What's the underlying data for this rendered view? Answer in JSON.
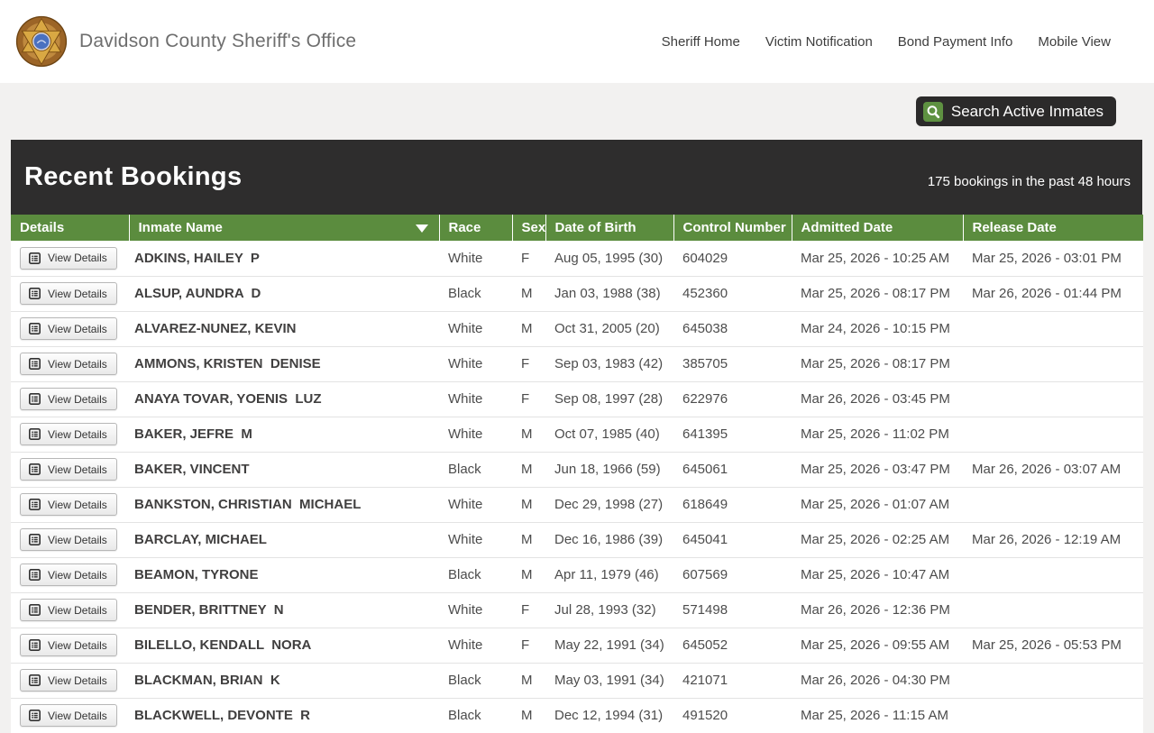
{
  "header": {
    "title": "Davidson County Sheriff's Office",
    "nav": [
      {
        "label": "Sheriff Home"
      },
      {
        "label": "Victim Notification"
      },
      {
        "label": "Bond Payment Info"
      },
      {
        "label": "Mobile View"
      }
    ]
  },
  "toolbar": {
    "search_label": "Search Active Inmates"
  },
  "bookings": {
    "title": "Recent Bookings",
    "summary": "175 bookings in the past 48 hours",
    "view_details_label": "View Details",
    "columns": [
      "Details",
      "Inmate Name",
      "Race",
      "Sex",
      "Date of Birth",
      "Control Number",
      "Admitted Date",
      "Release Date"
    ],
    "sorted_column": "Inmate Name",
    "sort_direction": "asc",
    "rows": [
      {
        "name": "ADKINS, HAILEY  P",
        "race": "White",
        "sex": "F",
        "dob": "Aug 05, 1995 (30)",
        "control": "604029",
        "admitted": "Mar 25, 2026 - 10:25 AM",
        "released": "Mar 25, 2026 - 03:01 PM"
      },
      {
        "name": "ALSUP, AUNDRA  D",
        "race": "Black",
        "sex": "M",
        "dob": "Jan 03, 1988 (38)",
        "control": "452360",
        "admitted": "Mar 25, 2026 - 08:17 PM",
        "released": "Mar 26, 2026 - 01:44 PM"
      },
      {
        "name": "ALVAREZ-NUNEZ, KEVIN",
        "race": "White",
        "sex": "M",
        "dob": "Oct 31, 2005 (20)",
        "control": "645038",
        "admitted": "Mar 24, 2026 - 10:15 PM",
        "released": ""
      },
      {
        "name": "AMMONS, KRISTEN  DENISE",
        "race": "White",
        "sex": "F",
        "dob": "Sep 03, 1983 (42)",
        "control": "385705",
        "admitted": "Mar 25, 2026 - 08:17 PM",
        "released": ""
      },
      {
        "name": "ANAYA TOVAR, YOENIS  LUZ",
        "race": "White",
        "sex": "F",
        "dob": "Sep 08, 1997 (28)",
        "control": "622976",
        "admitted": "Mar 26, 2026 - 03:45 PM",
        "released": ""
      },
      {
        "name": "BAKER, JEFRE  M",
        "race": "White",
        "sex": "M",
        "dob": "Oct 07, 1985 (40)",
        "control": "641395",
        "admitted": "Mar 25, 2026 - 11:02 PM",
        "released": ""
      },
      {
        "name": "BAKER, VINCENT",
        "race": "Black",
        "sex": "M",
        "dob": "Jun 18, 1966 (59)",
        "control": "645061",
        "admitted": "Mar 25, 2026 - 03:47 PM",
        "released": "Mar 26, 2026 - 03:07 AM"
      },
      {
        "name": "BANKSTON, CHRISTIAN  MICHAEL",
        "race": "White",
        "sex": "M",
        "dob": "Dec 29, 1998 (27)",
        "control": "618649",
        "admitted": "Mar 25, 2026 - 01:07 AM",
        "released": ""
      },
      {
        "name": "BARCLAY, MICHAEL",
        "race": "White",
        "sex": "M",
        "dob": "Dec 16, 1986 (39)",
        "control": "645041",
        "admitted": "Mar 25, 2026 - 02:25 AM",
        "released": "Mar 26, 2026 - 12:19 AM"
      },
      {
        "name": "BEAMON, TYRONE",
        "race": "Black",
        "sex": "M",
        "dob": "Apr 11, 1979 (46)",
        "control": "607569",
        "admitted": "Mar 25, 2026 - 10:47 AM",
        "released": ""
      },
      {
        "name": "BENDER, BRITTNEY  N",
        "race": "White",
        "sex": "F",
        "dob": "Jul 28, 1993 (32)",
        "control": "571498",
        "admitted": "Mar 26, 2026 - 12:36 PM",
        "released": ""
      },
      {
        "name": "BILELLO, KENDALL  NORA",
        "race": "White",
        "sex": "F",
        "dob": "May 22, 1991 (34)",
        "control": "645052",
        "admitted": "Mar 25, 2026 - 09:55 AM",
        "released": "Mar 25, 2026 - 05:53 PM"
      },
      {
        "name": "BLACKMAN, BRIAN  K",
        "race": "Black",
        "sex": "M",
        "dob": "May 03, 1991 (34)",
        "control": "421071",
        "admitted": "Mar 26, 2026 - 04:30 PM",
        "released": ""
      },
      {
        "name": "BLACKWELL, DEVONTE  R",
        "race": "Black",
        "sex": "M",
        "dob": "Dec 12, 1994 (31)",
        "control": "491520",
        "admitted": "Mar 25, 2026 - 11:15 AM",
        "released": ""
      }
    ]
  },
  "colors": {
    "table_header_green": "#5b8c3e",
    "dark_band": "#2e2d2d",
    "search_icon_green": "#5e9141",
    "page_background": "#f2f1f0"
  }
}
